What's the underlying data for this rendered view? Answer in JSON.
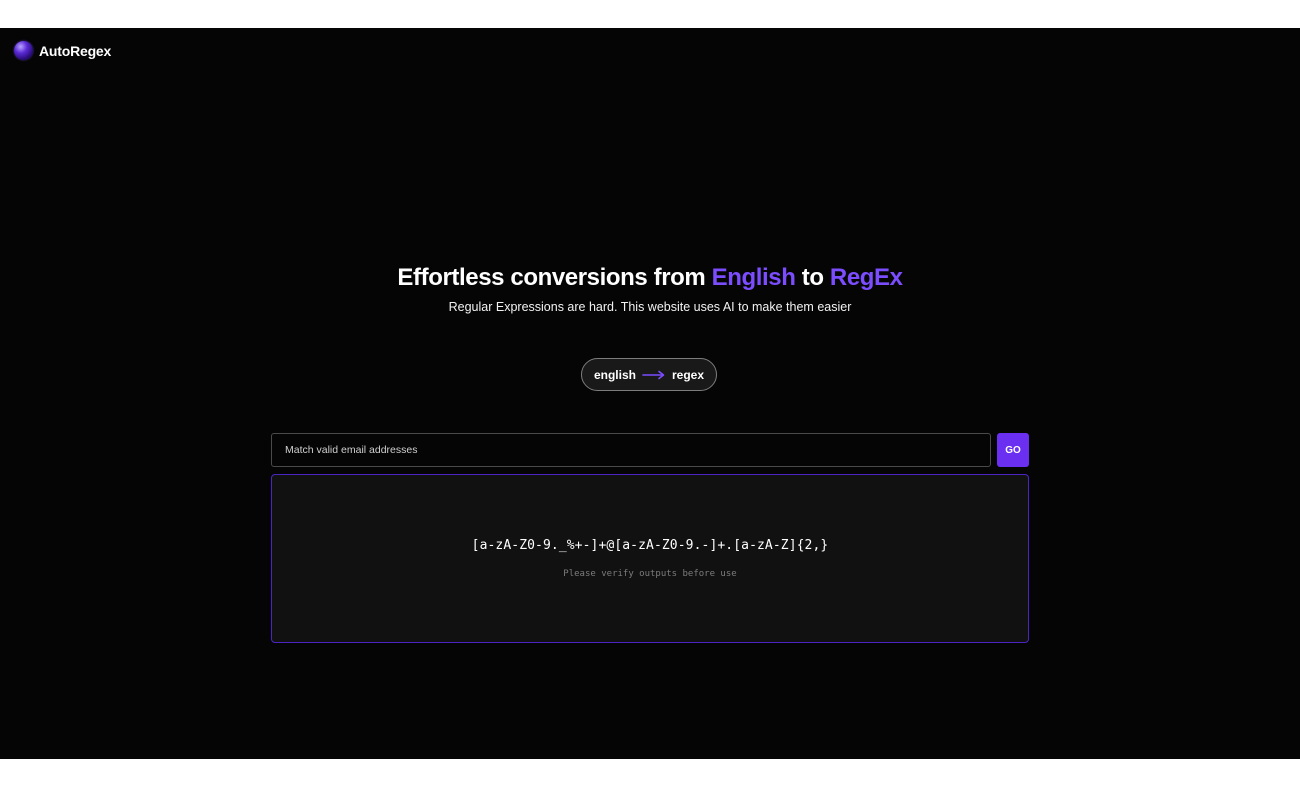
{
  "app": {
    "name": "AutoRegex",
    "accent_color": "#6a2ff0",
    "background_color": "#050505"
  },
  "hero": {
    "title_part1": "Effortless conversions from ",
    "title_accent1": "English",
    "title_part2": " to ",
    "title_accent2": "RegEx",
    "subtitle": "Regular Expressions are hard. This website uses AI to make them easier"
  },
  "mode_toggle": {
    "from_label": "english",
    "to_label": "regex",
    "icon": "arrow-right-icon"
  },
  "input": {
    "value": "",
    "placeholder": "Match valid email addresses"
  },
  "go_button": {
    "label": "GO"
  },
  "output": {
    "regex": "[a-zA-Z0-9._%+-]+@[a-zA-Z0-9.-]+.[a-zA-Z]{2,}",
    "disclaimer": "Please verify outputs before use"
  }
}
